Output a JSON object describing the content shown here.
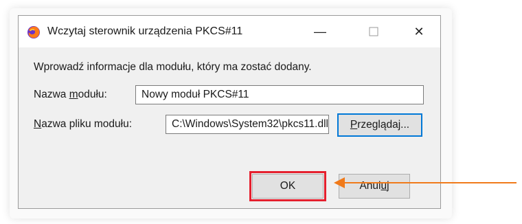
{
  "window": {
    "title": "Wczytaj sterownik urządzenia PKCS#11",
    "icon": "firefox-icon",
    "controls": {
      "minimize": "—",
      "maximize": "☐",
      "close": "✕"
    }
  },
  "dialog": {
    "instruction": "Wprowadź informacje dla modułu, który ma zostać dodany.",
    "module_name": {
      "label_prefix": "Nazwa ",
      "label_underlined": "m",
      "label_suffix": "odułu:",
      "value": "Nowy moduł PKCS#11"
    },
    "module_file": {
      "label_underlined": "N",
      "label_suffix": "azwa pliku modułu:",
      "value": "C:\\Windows\\System32\\pkcs11.dll"
    },
    "browse": {
      "underlined": "P",
      "suffix": "rzeglądaj..."
    },
    "ok_label": "OK",
    "cancel": {
      "prefix": "Anul",
      "underlined": "u",
      "suffix": "j"
    }
  },
  "annotation": {
    "highlight_color": "#e5202e",
    "arrow_color": "#f07a1a"
  }
}
